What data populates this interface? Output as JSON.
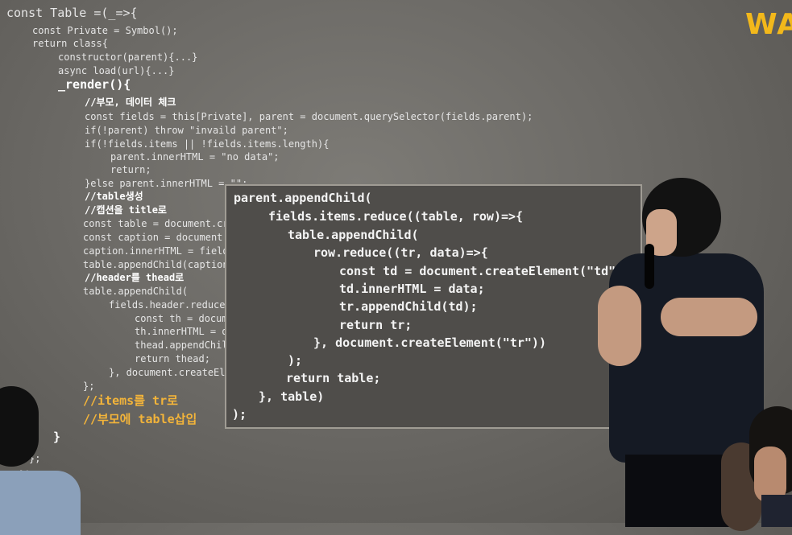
{
  "slide": {
    "brand_text": "WAV",
    "code_lines": [
      "const Table =(_=>{",
      "const Private = Symbol();",
      "return class{",
      "constructor(parent){...}",
      "async load(url){...}",
      "_render(){",
      "//부모, 데이터 체크",
      "const fields = this[Private], parent = document.querySelector(fields.parent);",
      "if(!parent) throw \"invaild parent\";",
      "if(!fields.items || !fields.items.length){",
      "parent.innerHTML = \"no data\";",
      "return;",
      "}else parent.innerHTML = \"\";",
      "//table생성",
      "//캡션을 title로",
      "const table = document.cre",
      "const caption = document.c",
      "caption.innerHTML = fields",
      "table.appendChild(caption)",
      "//header를 thead로",
      "table.appendChild(",
      "fields.header.reduce(",
      "const th = docum",
      "th.innerHTML = d",
      "thead.appendChil",
      "return thead;",
      "}, document.createEle",
      "};",
      "//items를 tr로",
      "//부모에 table삽입",
      "}",
      "};",
      "});"
    ]
  },
  "popup": {
    "lines": [
      "parent.appendChild(",
      "fields.items.reduce((table, row)=>{",
      "table.appendChild(",
      "row.reduce((tr, data)=>{",
      "const td = document.createElement(\"td\");",
      "td.innerHTML = data;",
      "tr.appendChild(td);",
      "return tr;",
      "}, document.createElement(\"tr\"))",
      ");",
      "return table;",
      "}, table)",
      ");"
    ]
  }
}
